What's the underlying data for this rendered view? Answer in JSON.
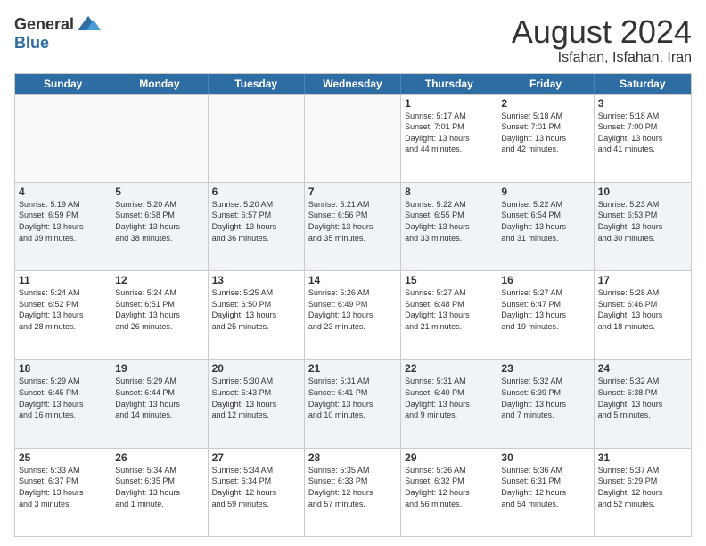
{
  "header": {
    "logo": {
      "general": "General",
      "blue": "Blue"
    },
    "title": "August 2024",
    "location": "Isfahan, Isfahan, Iran"
  },
  "weekdays": [
    "Sunday",
    "Monday",
    "Tuesday",
    "Wednesday",
    "Thursday",
    "Friday",
    "Saturday"
  ],
  "rows": [
    [
      {
        "day": "",
        "info": ""
      },
      {
        "day": "",
        "info": ""
      },
      {
        "day": "",
        "info": ""
      },
      {
        "day": "",
        "info": ""
      },
      {
        "day": "1",
        "info": "Sunrise: 5:17 AM\nSunset: 7:01 PM\nDaylight: 13 hours\nand 44 minutes."
      },
      {
        "day": "2",
        "info": "Sunrise: 5:18 AM\nSunset: 7:01 PM\nDaylight: 13 hours\nand 42 minutes."
      },
      {
        "day": "3",
        "info": "Sunrise: 5:18 AM\nSunset: 7:00 PM\nDaylight: 13 hours\nand 41 minutes."
      }
    ],
    [
      {
        "day": "4",
        "info": "Sunrise: 5:19 AM\nSunset: 6:59 PM\nDaylight: 13 hours\nand 39 minutes."
      },
      {
        "day": "5",
        "info": "Sunrise: 5:20 AM\nSunset: 6:58 PM\nDaylight: 13 hours\nand 38 minutes."
      },
      {
        "day": "6",
        "info": "Sunrise: 5:20 AM\nSunset: 6:57 PM\nDaylight: 13 hours\nand 36 minutes."
      },
      {
        "day": "7",
        "info": "Sunrise: 5:21 AM\nSunset: 6:56 PM\nDaylight: 13 hours\nand 35 minutes."
      },
      {
        "day": "8",
        "info": "Sunrise: 5:22 AM\nSunset: 6:55 PM\nDaylight: 13 hours\nand 33 minutes."
      },
      {
        "day": "9",
        "info": "Sunrise: 5:22 AM\nSunset: 6:54 PM\nDaylight: 13 hours\nand 31 minutes."
      },
      {
        "day": "10",
        "info": "Sunrise: 5:23 AM\nSunset: 6:53 PM\nDaylight: 13 hours\nand 30 minutes."
      }
    ],
    [
      {
        "day": "11",
        "info": "Sunrise: 5:24 AM\nSunset: 6:52 PM\nDaylight: 13 hours\nand 28 minutes."
      },
      {
        "day": "12",
        "info": "Sunrise: 5:24 AM\nSunset: 6:51 PM\nDaylight: 13 hours\nand 26 minutes."
      },
      {
        "day": "13",
        "info": "Sunrise: 5:25 AM\nSunset: 6:50 PM\nDaylight: 13 hours\nand 25 minutes."
      },
      {
        "day": "14",
        "info": "Sunrise: 5:26 AM\nSunset: 6:49 PM\nDaylight: 13 hours\nand 23 minutes."
      },
      {
        "day": "15",
        "info": "Sunrise: 5:27 AM\nSunset: 6:48 PM\nDaylight: 13 hours\nand 21 minutes."
      },
      {
        "day": "16",
        "info": "Sunrise: 5:27 AM\nSunset: 6:47 PM\nDaylight: 13 hours\nand 19 minutes."
      },
      {
        "day": "17",
        "info": "Sunrise: 5:28 AM\nSunset: 6:46 PM\nDaylight: 13 hours\nand 18 minutes."
      }
    ],
    [
      {
        "day": "18",
        "info": "Sunrise: 5:29 AM\nSunset: 6:45 PM\nDaylight: 13 hours\nand 16 minutes."
      },
      {
        "day": "19",
        "info": "Sunrise: 5:29 AM\nSunset: 6:44 PM\nDaylight: 13 hours\nand 14 minutes."
      },
      {
        "day": "20",
        "info": "Sunrise: 5:30 AM\nSunset: 6:43 PM\nDaylight: 13 hours\nand 12 minutes."
      },
      {
        "day": "21",
        "info": "Sunrise: 5:31 AM\nSunset: 6:41 PM\nDaylight: 13 hours\nand 10 minutes."
      },
      {
        "day": "22",
        "info": "Sunrise: 5:31 AM\nSunset: 6:40 PM\nDaylight: 13 hours\nand 9 minutes."
      },
      {
        "day": "23",
        "info": "Sunrise: 5:32 AM\nSunset: 6:39 PM\nDaylight: 13 hours\nand 7 minutes."
      },
      {
        "day": "24",
        "info": "Sunrise: 5:32 AM\nSunset: 6:38 PM\nDaylight: 13 hours\nand 5 minutes."
      }
    ],
    [
      {
        "day": "25",
        "info": "Sunrise: 5:33 AM\nSunset: 6:37 PM\nDaylight: 13 hours\nand 3 minutes."
      },
      {
        "day": "26",
        "info": "Sunrise: 5:34 AM\nSunset: 6:35 PM\nDaylight: 13 hours\nand 1 minute."
      },
      {
        "day": "27",
        "info": "Sunrise: 5:34 AM\nSunset: 6:34 PM\nDaylight: 12 hours\nand 59 minutes."
      },
      {
        "day": "28",
        "info": "Sunrise: 5:35 AM\nSunset: 6:33 PM\nDaylight: 12 hours\nand 57 minutes."
      },
      {
        "day": "29",
        "info": "Sunrise: 5:36 AM\nSunset: 6:32 PM\nDaylight: 12 hours\nand 56 minutes."
      },
      {
        "day": "30",
        "info": "Sunrise: 5:36 AM\nSunset: 6:31 PM\nDaylight: 12 hours\nand 54 minutes."
      },
      {
        "day": "31",
        "info": "Sunrise: 5:37 AM\nSunset: 6:29 PM\nDaylight: 12 hours\nand 52 minutes."
      }
    ]
  ]
}
